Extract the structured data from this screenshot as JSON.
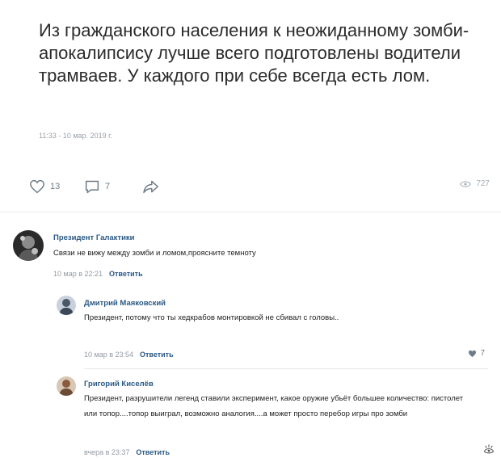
{
  "post": {
    "text": "Из гражданского населения к неожиданному зомби-апокалипсису лучше всего подготовлены водители трамваев. У каждого при себе всегда есть лом.",
    "time": "11:33 - 10 мар. 2019 г."
  },
  "actions": {
    "likes": "13",
    "comments": "7",
    "views": "727"
  },
  "comments": [
    {
      "author": "Президент Галактики",
      "text": "Связи не вижу между зомби и ломом,проясните темноту",
      "date": "10 мар в 22:21",
      "reply_label": "Ответить"
    },
    {
      "author": "Дмитрий Маяковский",
      "text": "Президент, потому что ты хедкрабов монтировкой не сбивал с головы..",
      "date": "10 мар в 23:54",
      "reply_label": "Ответить",
      "likes": "7"
    },
    {
      "author": "Григорий Киселёв",
      "text": "Президент, разрушители легенд ставили эксперимент, какое оружие убьёт большее количество: пистолет или топор....топор выиграл, возможно аналогия....а может просто перебор игры про зомби",
      "date": "вчера в 23:37",
      "reply_label": "Ответить"
    }
  ],
  "colors": {
    "link": "#2a5885",
    "icon": "#6e7b88",
    "muted": "#939ba3"
  },
  "icons": [
    "heart-icon",
    "comment-icon",
    "share-icon",
    "eye-icon",
    "heart-small-icon",
    "watermark-icon"
  ]
}
